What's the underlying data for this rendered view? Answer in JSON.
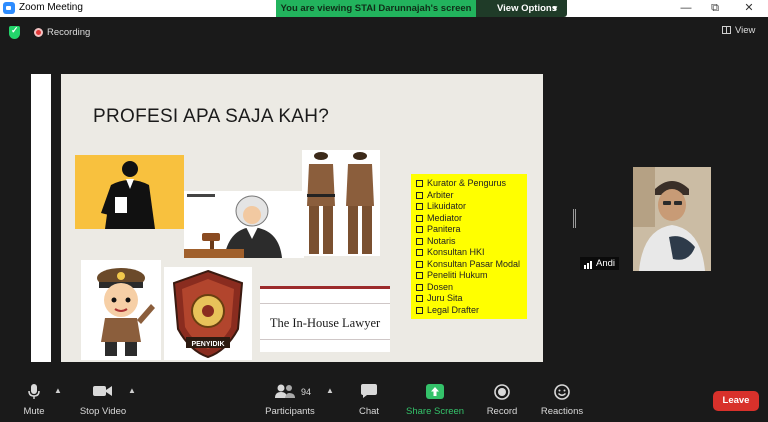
{
  "window": {
    "title": "Zoom Meeting",
    "controls": [
      "—",
      "⧉",
      "✕"
    ]
  },
  "share_banner": {
    "text": "You are viewing STAI Darunnajah's screen",
    "view_options": "View Options"
  },
  "status": {
    "recording": "Recording",
    "view": "View"
  },
  "slide": {
    "title": "PROFESI APA SAJA KAH?",
    "inhouse_text": "The In-House Lawyer",
    "badge_text": "PENYIDIK",
    "list": [
      "Kurator & Pengurus",
      "Arbiter",
      "Likuidator",
      "Mediator",
      "Panitera",
      "Notaris",
      "Konsultan HKI",
      "Konsultan Pasar Modal",
      "Peneliti Hukum",
      "Dosen",
      "Juru Sita",
      "Legal Drafter"
    ]
  },
  "participant": {
    "name": "Andi"
  },
  "toolbar": {
    "mute": "Mute",
    "stop_video": "Stop Video",
    "participants": "Participants",
    "participants_count": "94",
    "chat": "Chat",
    "share_screen": "Share Screen",
    "record": "Record",
    "reactions": "Reactions",
    "leave": "Leave"
  },
  "colors": {
    "share_green": "#22b35d",
    "leave_red": "#d8312b",
    "list_yellow": "#ffff00"
  }
}
